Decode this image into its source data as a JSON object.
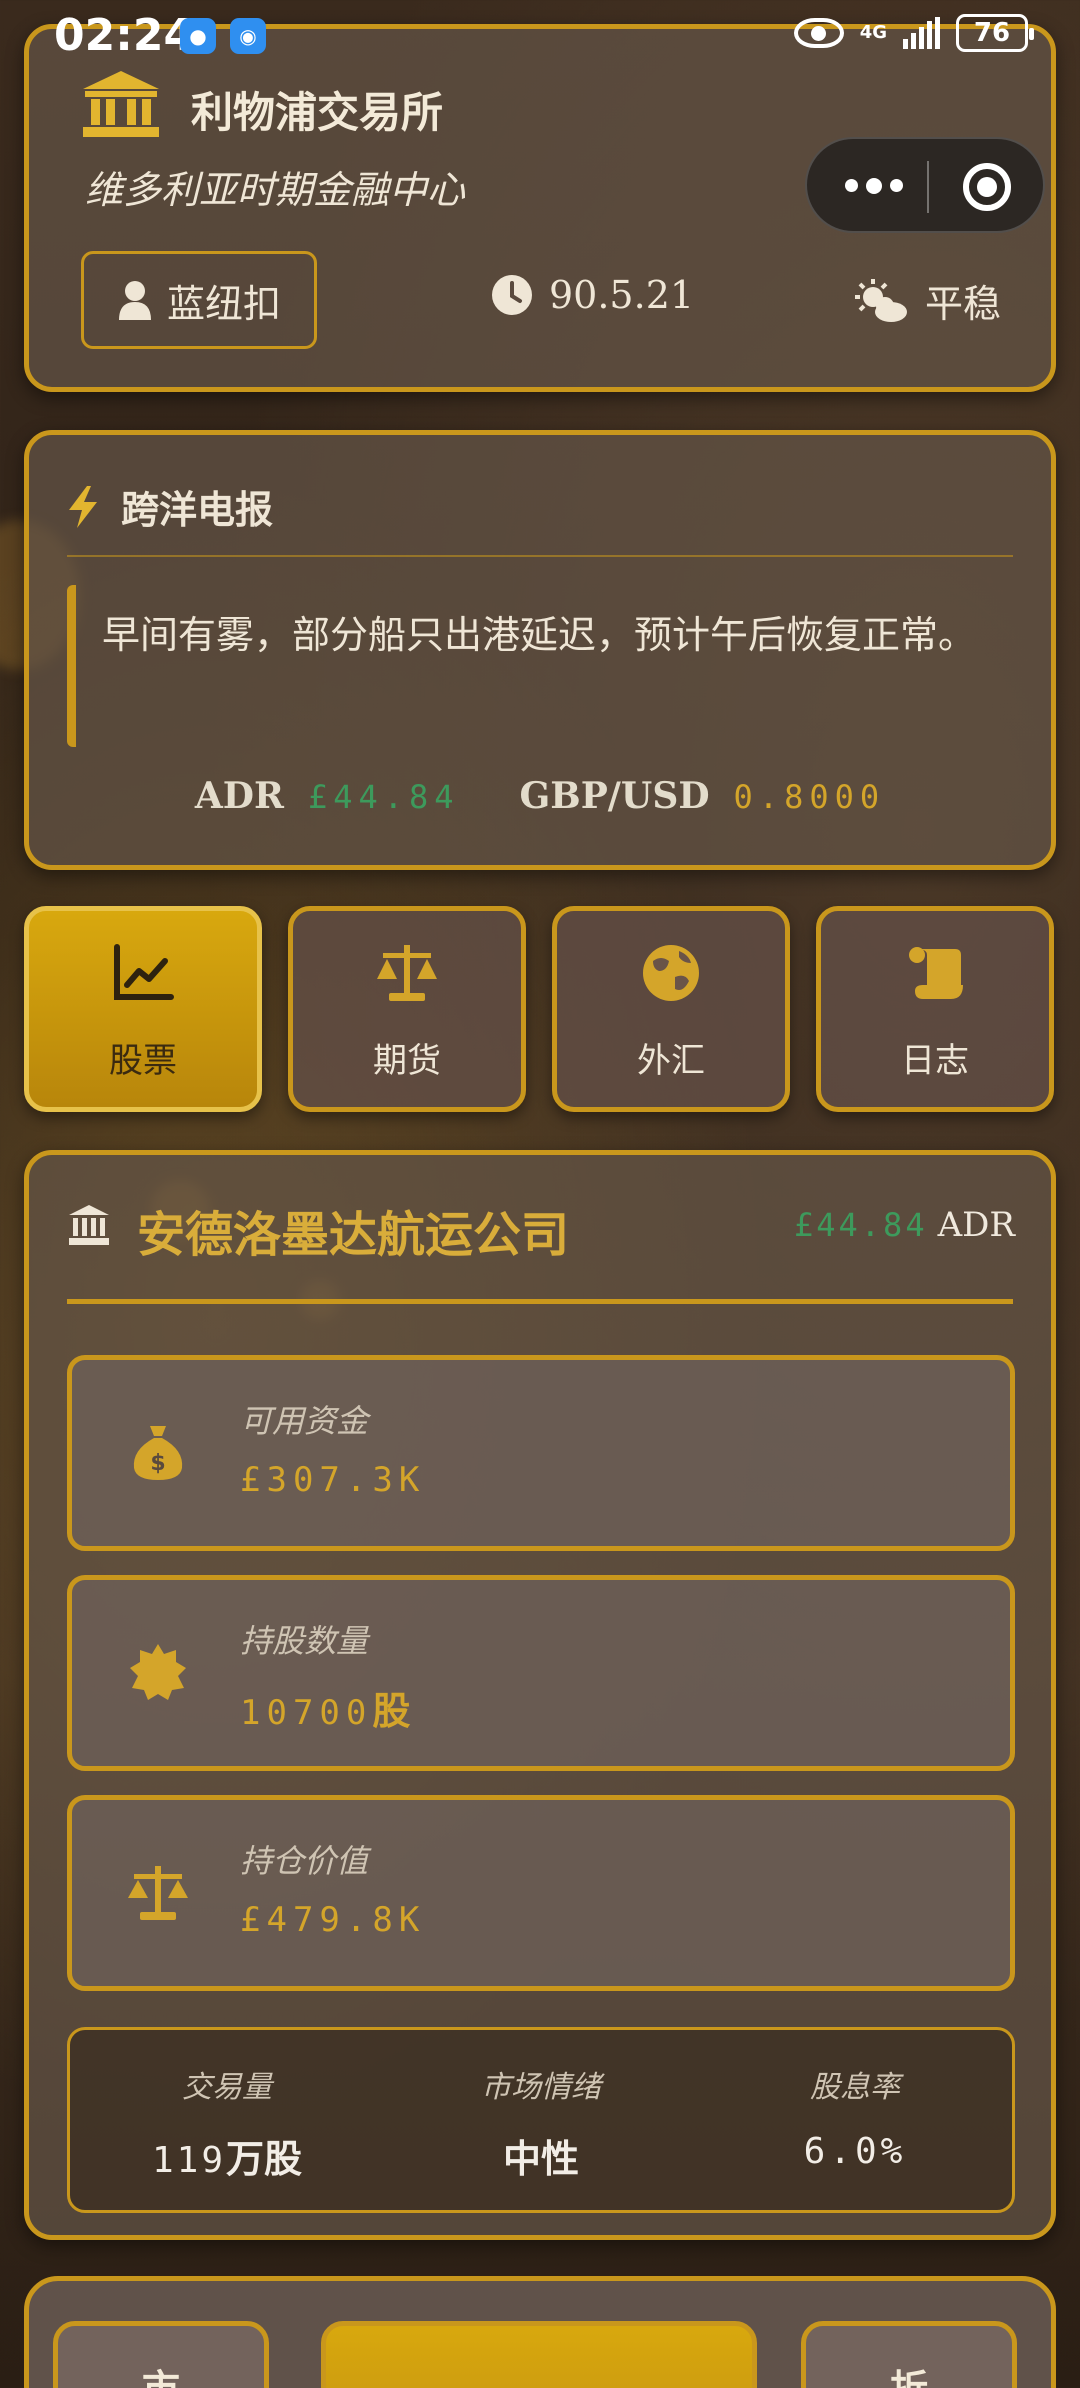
{
  "status_bar": {
    "time": "02:24",
    "network": "4G",
    "battery": "76"
  },
  "header": {
    "title": "利物浦交易所",
    "subtitle": "维多利亚时期金融中心",
    "player_name": "蓝纽扣",
    "date": "90.5.21",
    "weather": "平稳",
    "icons": [
      "bank-icon",
      "user-icon",
      "clock-icon",
      "cloud-sun-icon",
      "more-dots-icon",
      "target-close-icon"
    ]
  },
  "telegram": {
    "title": "跨洋电报",
    "message": "早间有雾，部分船只出港延迟，预计午后恢复正常。",
    "tickers": [
      {
        "symbol": "ADR",
        "value": "£44.84",
        "color": "#3d9a5c"
      },
      {
        "symbol": "GBP/USD",
        "value": "0.8000",
        "color": "#d4a52a"
      }
    ]
  },
  "tabs": [
    {
      "label": "股票",
      "icon": "chart-line-icon",
      "active": true
    },
    {
      "label": "期货",
      "icon": "scale-icon",
      "active": false
    },
    {
      "label": "外汇",
      "icon": "globe-icon",
      "active": false
    },
    {
      "label": "日志",
      "icon": "scroll-icon",
      "active": false
    }
  ],
  "company": {
    "name": "安德洛墨达航运公司",
    "price": "£44.84",
    "symbol": "ADR",
    "stats": [
      {
        "label": "可用资金",
        "value": "£307.3K",
        "unit": "",
        "icon": "money-bag-icon"
      },
      {
        "label": "持股数量",
        "value": "10700",
        "unit": "股",
        "icon": "badge-icon"
      },
      {
        "label": "持仓价值",
        "value": "£479.8K",
        "unit": "",
        "icon": "scale-icon"
      }
    ],
    "metrics": [
      {
        "label": "交易量",
        "value": "119",
        "unit": "万股"
      },
      {
        "label": "市场情绪",
        "value": "",
        "unit": "中性"
      },
      {
        "label": "股息率",
        "value": "6.0%",
        "unit": ""
      }
    ]
  },
  "bottom_panel": {
    "left_label": "市",
    "right_label": "折"
  },
  "colors": {
    "gold": "#c9971c",
    "gold_text": "#d4a52a",
    "green_price": "#3d9a5c",
    "active_tab": "#d8a80e"
  }
}
